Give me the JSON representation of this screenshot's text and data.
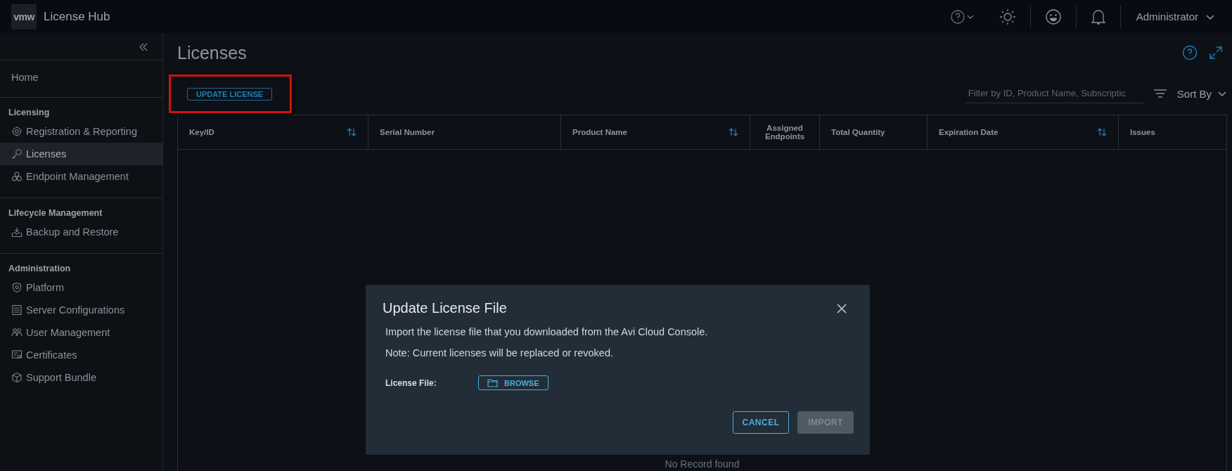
{
  "header": {
    "logo": "vmw",
    "title": "License Hub",
    "user": "Administrator"
  },
  "sidebar": {
    "home": {
      "label": "Home",
      "selected": false
    },
    "sections": [
      {
        "heading": "Licensing",
        "items": [
          {
            "label": "Registration & Reporting",
            "selected": false
          },
          {
            "label": "Licenses",
            "selected": true
          },
          {
            "label": "Endpoint Management",
            "selected": false
          }
        ]
      },
      {
        "heading": "Lifecycle Management",
        "items": [
          {
            "label": "Backup and Restore",
            "selected": false
          }
        ]
      },
      {
        "heading": "Administration",
        "items": [
          {
            "label": "Platform",
            "selected": false
          },
          {
            "label": "Server Configurations",
            "selected": false
          },
          {
            "label": "User Management",
            "selected": false
          },
          {
            "label": "Certificates",
            "selected": false
          },
          {
            "label": "Support Bundle",
            "selected": false
          }
        ]
      }
    ]
  },
  "page": {
    "title": "Licenses",
    "action": "UPDATE LICENSE",
    "filter": {
      "placeholder": "Filter by ID, Product Name, Subscriptic"
    },
    "sort": "Sort By"
  },
  "table": {
    "columns": [
      {
        "label": "Key/ID",
        "sortable": true
      },
      {
        "label": "Serial Number",
        "sortable": false
      },
      {
        "label": "Product Name",
        "sortable": true
      },
      {
        "label": "Assigned Endpoints",
        "sortable": false
      },
      {
        "label": "Total Quantity",
        "sortable": false
      },
      {
        "label": "Expiration Date",
        "sortable": true
      },
      {
        "label": "Issues",
        "sortable": false
      }
    ],
    "empty": "No Record found"
  },
  "dialog": {
    "title": "Update License File",
    "lines": [
      "Import the license file that you downloaded from the Avi Cloud Console.",
      "Note: Current licenses will be replaced or revoked."
    ],
    "field_label": "License File:",
    "browse": "BROWSE",
    "buttons": [
      {
        "label": "CANCEL",
        "disabled": false
      },
      {
        "label": "IMPORT",
        "disabled": true
      }
    ]
  }
}
